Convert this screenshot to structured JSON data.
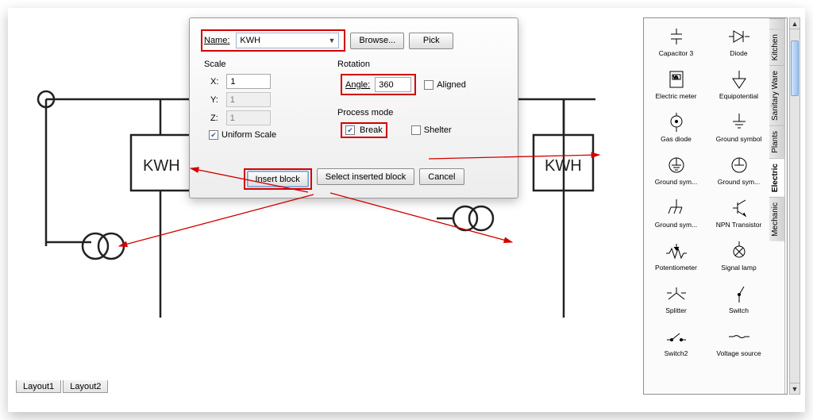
{
  "tabs": {
    "t1": "Layout1",
    "t2": "Layout2"
  },
  "dialog": {
    "name_label": "Name:",
    "name_value": "KWH",
    "browse": "Browse...",
    "pick": "Pick",
    "scale_title": "Scale",
    "scale_x_label": "X:",
    "scale_y_label": "Y:",
    "scale_z_label": "Z:",
    "scale_x": "1",
    "scale_y": "1",
    "scale_z": "1",
    "uniform_label": "Uniform Scale",
    "rotation_title": "Rotation",
    "angle_label": "Angle:",
    "angle_value": "360",
    "aligned_label": "Aligned",
    "process_title": "Process mode",
    "break_label": "Break",
    "shelter_label": "Shelter",
    "insert": "Insert block",
    "select_inserted": "Select inserted block",
    "cancel": "Cancel"
  },
  "canvas": {
    "kwh_text": "KWH"
  },
  "palette": {
    "categories": {
      "c0": " ",
      "kitchen": "Kitchen",
      "sanitary": "Sanitary Ware",
      "plants": "Plants",
      "electric": "Electric",
      "mechanic": "Mechanic"
    },
    "items": {
      "i0": "Capacitor 3",
      "i1": "Diode",
      "i2": "Electric meter",
      "i3": "Equipotential",
      "i4": "Gas diode",
      "i5": "Ground symbol",
      "i6": "Ground sym...",
      "i7": "Ground sym...",
      "i8": "Ground sym...",
      "i9": "NPN Transistor",
      "i10": "Potentiometer",
      "i11": "Signal lamp",
      "i12": "Splitter",
      "i13": "Switch",
      "i14": "Switch2",
      "i15": "Voltage source"
    }
  }
}
